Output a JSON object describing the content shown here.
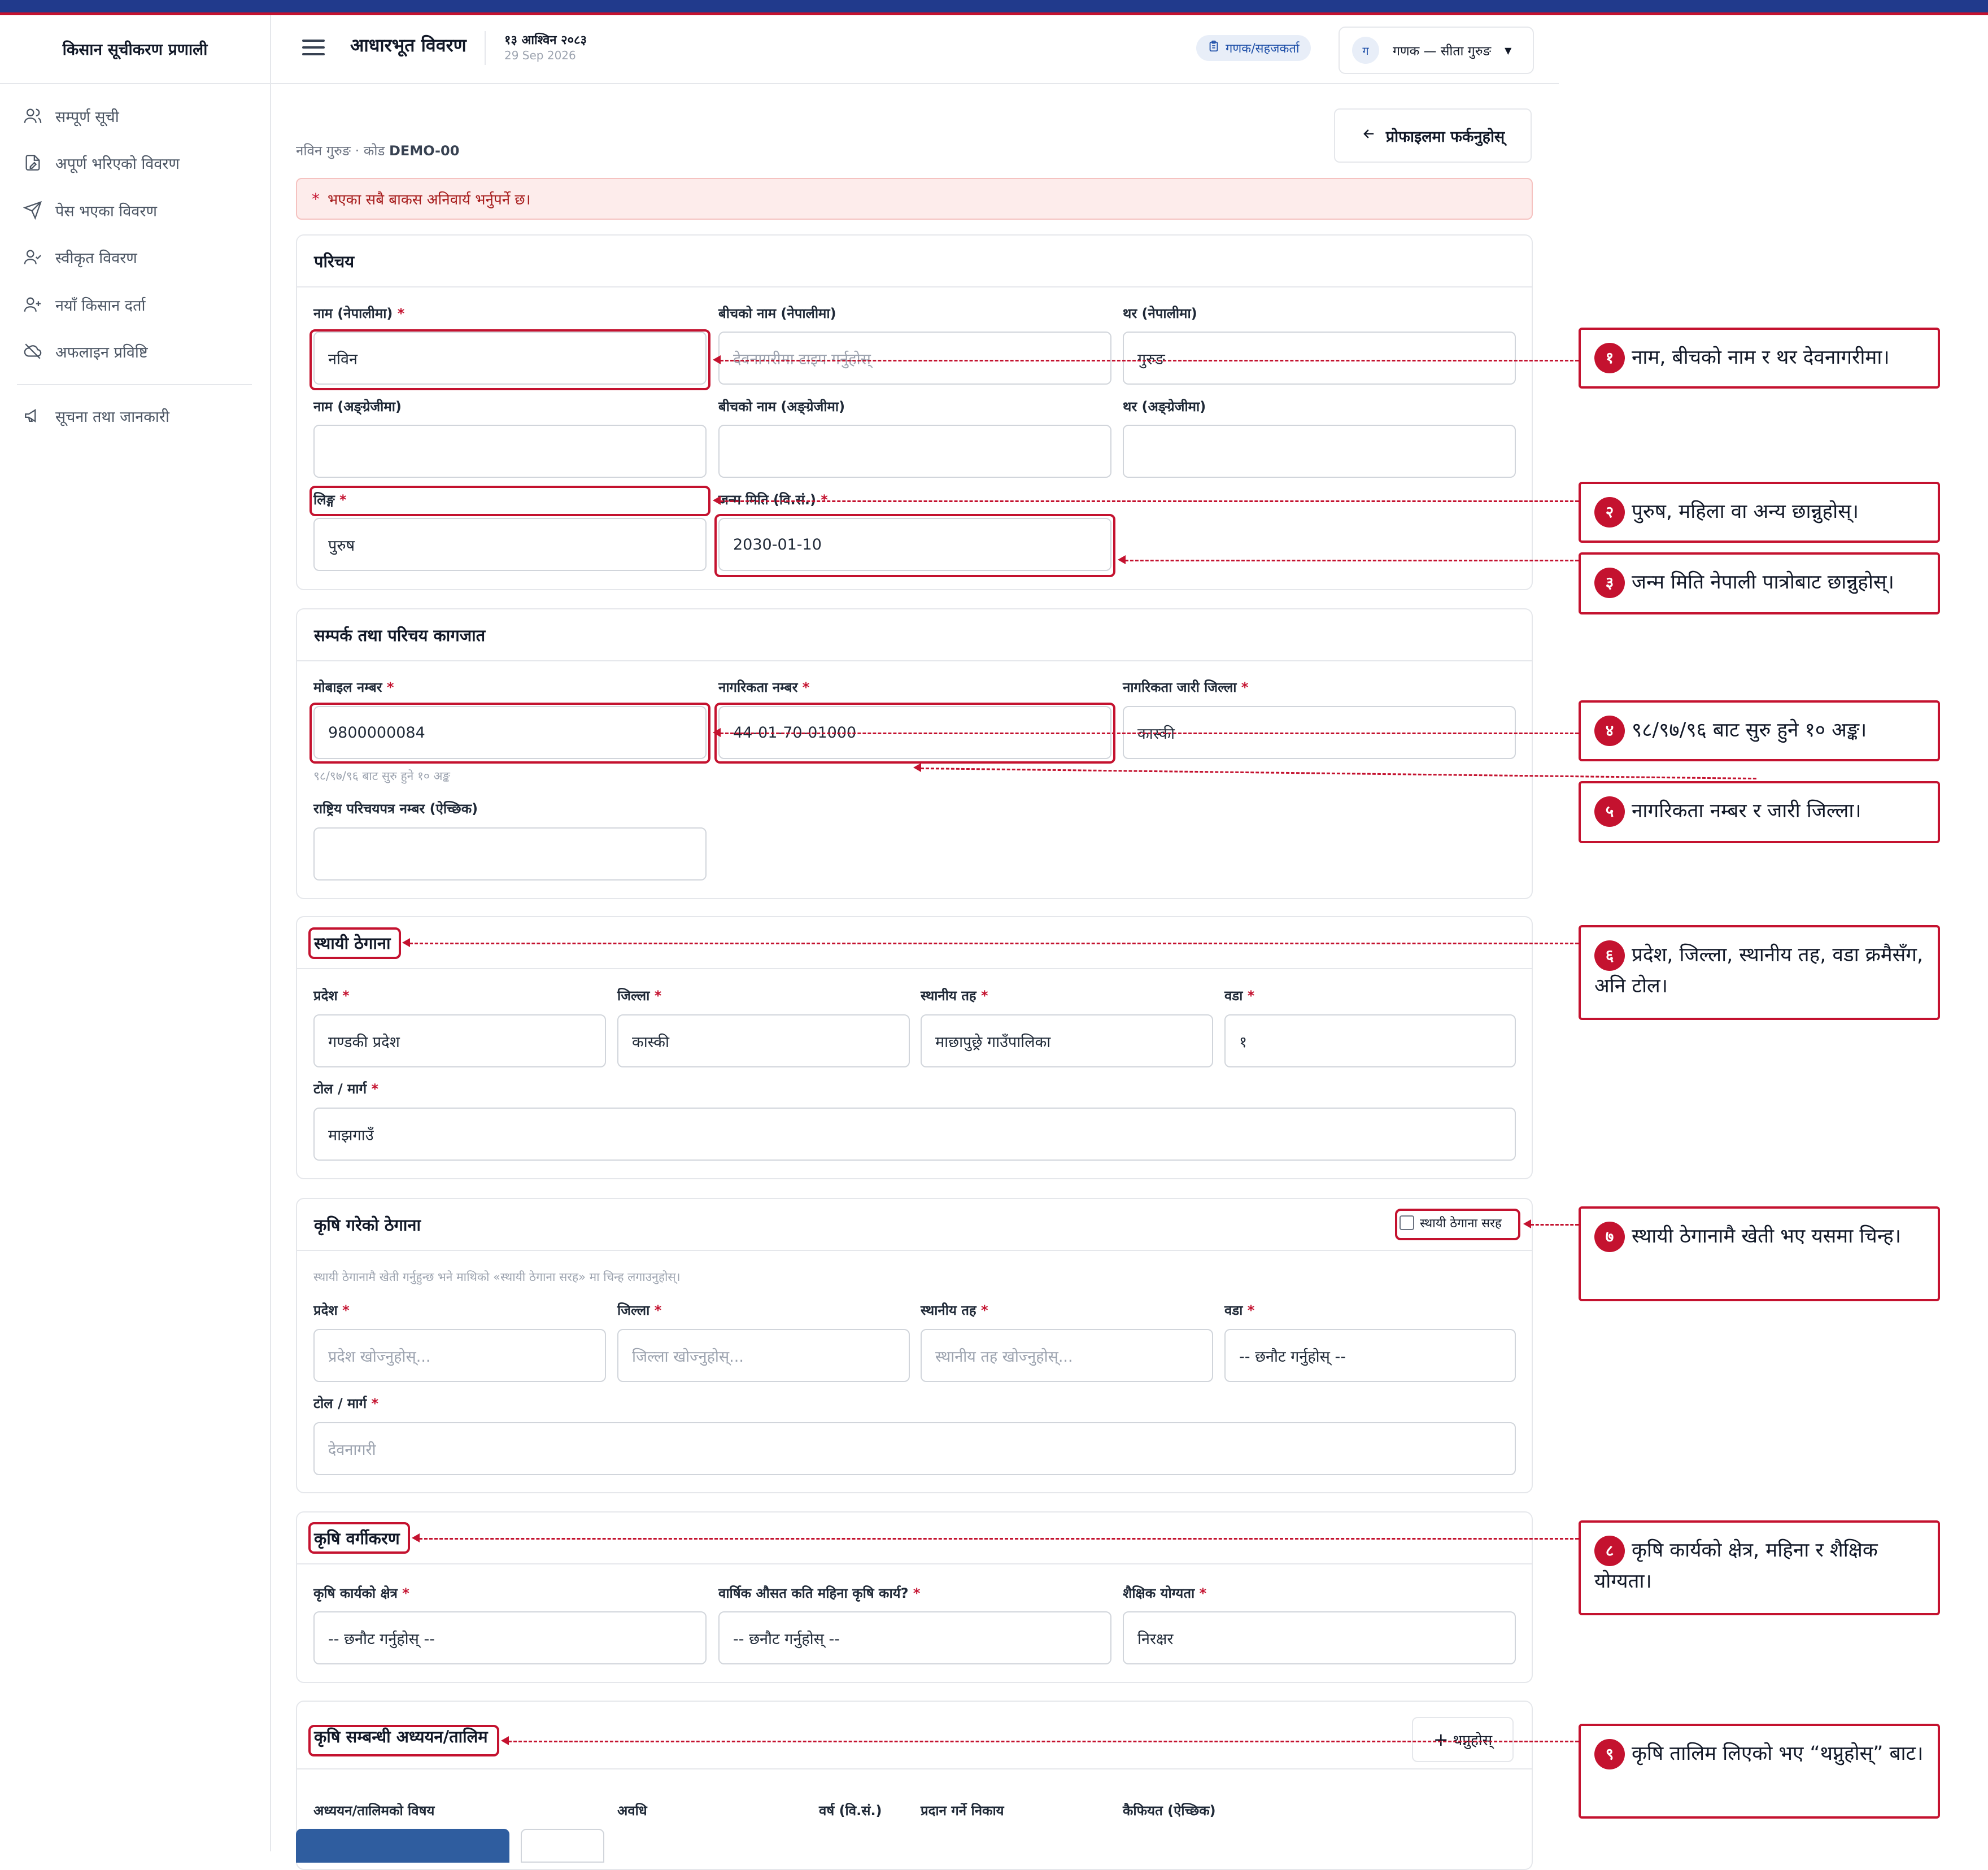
{
  "app": {
    "name": "किसान सूचीकरण प्रणाली"
  },
  "sidebar": {
    "items": [
      {
        "label": "सम्पूर्ण सूची",
        "icon": "users-icon"
      },
      {
        "label": "अपूर्ण भरिएको विवरण",
        "icon": "file-edit-icon"
      },
      {
        "label": "पेस भएका विवरण",
        "icon": "send-icon"
      },
      {
        "label": "स्वीकृत विवरण",
        "icon": "user-check-icon"
      },
      {
        "label": "नयाँ किसान दर्ता",
        "icon": "user-plus-icon"
      },
      {
        "label": "अफलाइन प्रविष्टि",
        "icon": "cloud-off-icon"
      },
      {
        "label": "सूचना तथा जानकारी",
        "icon": "megaphone-icon"
      }
    ]
  },
  "header": {
    "title": "आधारभूत विवरण",
    "date_np": "१३ आश्विन २०८३",
    "date_en": "29 Sep 2026",
    "role": "गणक/सहजकर्ता",
    "user_initial": "ग",
    "user_name": "गणक — सीता गुरुङ"
  },
  "back_button": "प्रोफाइलमा फर्कनुहोस्",
  "breadcrumb": {
    "name": "नविन गुरुङ · कोड",
    "code": "DEMO-00"
  },
  "alert": "भएका सबै बाकस अनिवार्य भर्नुपर्ने छ।",
  "sections": {
    "intro": {
      "title": "परिचय",
      "first_np_label": "नाम (नेपालीमा)",
      "first_np_value": "नविन",
      "middle_np_label": "बीचको नाम (नेपालीमा)",
      "middle_np_placeholder": "देवनागरीमा टाइप गर्नुहोस्",
      "last_np_label": "थर (नेपालीमा)",
      "last_np_value": "गुरुङ",
      "first_en_label": "नाम (अङ्ग्रेजीमा)",
      "middle_en_label": "बीचको नाम (अङ्ग्रेजीमा)",
      "last_en_label": "थर (अङ्ग्रेजीमा)",
      "gender_label": "लिङ्ग",
      "gender_value": "पुरुष",
      "dob_label": "जन्म मिति (वि.सं.)",
      "dob_value": "2030-01-10"
    },
    "contact": {
      "title": "सम्पर्क तथा परिचय कागजात",
      "mobile_label": "मोबाइल नम्बर",
      "mobile_value": "9800000084",
      "mobile_hint": "९८/९७/९६ बाट सुरु हुने १० अङ्क",
      "citizen_label": "नागरिकता नम्बर",
      "citizen_value": "44-01-70-01000",
      "district_label": "नागरिकता जारी जिल्ला",
      "district_value": "कास्की",
      "nid_label": "राष्ट्रिय परिचयपत्र नम्बर (ऐच्छिक)"
    },
    "permanent": {
      "title": "स्थायी ठेगाना",
      "province_label": "प्रदेश",
      "province_value": "गण्डकी प्रदेश",
      "district_label": "जिल्ला",
      "district_value": "कास्की",
      "local_label": "स्थानीय तह",
      "local_value": "माछापुछ्रे गाउँपालिका",
      "ward_label": "वडा",
      "ward_value": "१",
      "tole_label": "टोल / मार्ग",
      "tole_value": "माझगाउँ"
    },
    "farm_address": {
      "title": "कृषि गरेको ठेगाना",
      "same_label": "स्थायी ठेगाना सरह",
      "hint": "स्थायी ठेगानामै खेती गर्नुहुन्छ भने माथिको «स्थायी ठेगाना सरह» मा चिन्ह लगाउनुहोस्।",
      "province_label": "प्रदेश",
      "province_placeholder": "प्रदेश खोज्नुहोस्...",
      "district_label": "जिल्ला",
      "district_placeholder": "जिल्ला खोज्नुहोस्...",
      "local_label": "स्थानीय तह",
      "local_placeholder": "स्थानीय तह खोज्नुहोस्...",
      "ward_label": "वडा",
      "ward_value": "-- छनौट गर्नुहोस् --",
      "tole_label": "टोल / मार्ग",
      "tole_placeholder": "देवनागरी"
    },
    "classification": {
      "title": "कृषि वर्गीकरण",
      "sector_label": "कृषि कार्यको क्षेत्र",
      "sector_value": "-- छनौट गर्नुहोस् --",
      "months_label": "वार्षिक औसत कति महिना कृषि कार्य?",
      "months_value": "-- छनौट गर्नुहोस् --",
      "edu_label": "शैक्षिक योग्यता",
      "edu_value": "निरक्षर"
    },
    "training": {
      "title": "कृषि सम्बन्धी अध्ययन/तालिम",
      "add_label": "थप्नुहोस्",
      "columns": [
        "अध्ययन/तालिमको विषय",
        "अवधि",
        "वर्ष (वि.सं.)",
        "प्रदान गर्ने निकाय",
        "कैफियत (ऐच्छिक)"
      ]
    }
  },
  "callouts": [
    {
      "num": "१",
      "text": "नाम, बीचको नाम र थर देवनागरीमा।"
    },
    {
      "num": "२",
      "text": "पुरुष, महिला वा अन्य छान्नुहोस्।"
    },
    {
      "num": "३",
      "text": "जन्म मिति नेपाली पात्रोबाट छान्नुहोस्।"
    },
    {
      "num": "४",
      "text": "९८/९७/९६ बाट सुरु हुने १० अङ्क।"
    },
    {
      "num": "५",
      "text": "नागरिकता नम्बर र जारी जिल्ला।"
    },
    {
      "num": "६",
      "text": "प्रदेश, जिल्ला, स्थानीय तह, वडा क्रमैसँग, अनि टोल।"
    },
    {
      "num": "७",
      "text": "स्थायी ठेगानामै खेती भए यसमा चिन्ह।"
    },
    {
      "num": "८",
      "text": "कृषि कार्यको क्षेत्र, महिना र शैक्षिक योग्यता।"
    },
    {
      "num": "९",
      "text": "कृषि तालिम लिएको भए “थप्नुहोस्” बाट।"
    }
  ],
  "footer": {
    "primary": "",
    "secondary": ""
  },
  "colors": {
    "accent": "#c4122f",
    "brand": "#213a8c",
    "primary": "#2f5d9f"
  }
}
